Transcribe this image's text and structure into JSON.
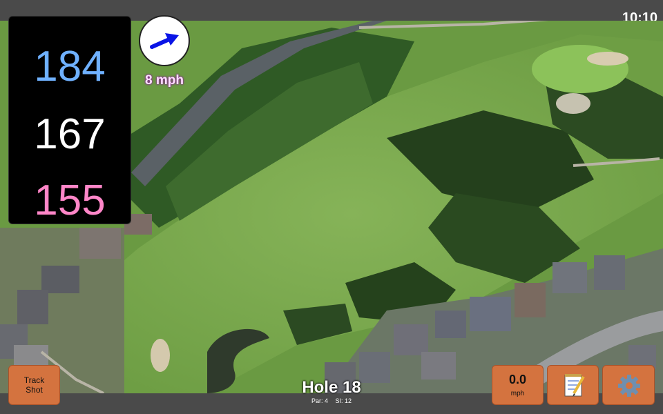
{
  "clock": "10:10",
  "distances": {
    "back": "184",
    "middle": "167",
    "front": "155"
  },
  "wind": {
    "speed": "8 mph",
    "icon": "wind-arrow-icon"
  },
  "buttons": {
    "track_shot": "Track\nShot",
    "speed_value": "0.0",
    "speed_unit": "mph",
    "notes_icon": "notepad-icon",
    "settings_icon": "gear-icon"
  },
  "hole": {
    "title": "Hole 18",
    "par": "Par: 4",
    "si": "SI: 12"
  },
  "colors": {
    "back_distance": "#6fb1ff",
    "middle_distance": "#ffffff",
    "front_distance": "#ff86c8",
    "button": "#d4733f",
    "wind_arrow": "#0a14e6"
  }
}
